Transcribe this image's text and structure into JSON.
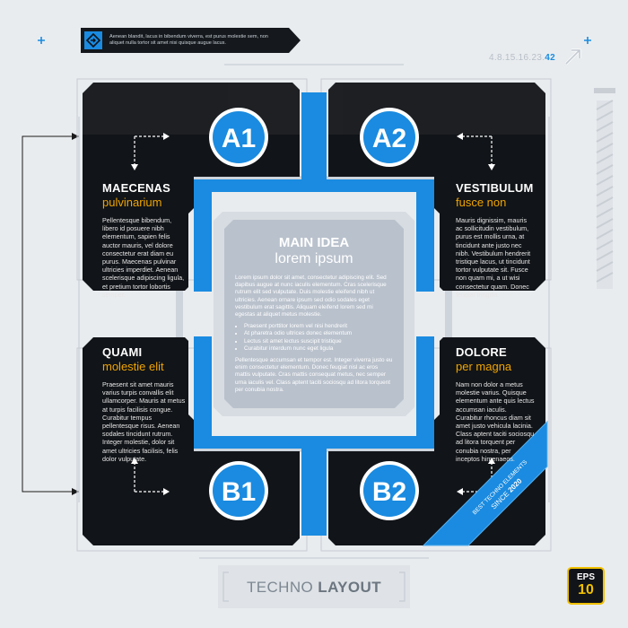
{
  "header": {
    "text_line1": "Aenean blandit, lacus in bibendum viverra, est purus molestie sem, non",
    "text_line2": "aliquet nulla tortor sit amet nisi quisque augue lacus.",
    "numbers_prefix": "4.8.15.16.23.",
    "numbers_highlight": "42"
  },
  "panels": {
    "a1": {
      "badge": "A1",
      "title": "MAECENAS",
      "subtitle": "pulvinarium",
      "body": "Pellentesque bibendum, libero id posuere nibh elementum, sapien felis auctor mauris, vel dolore consectetur erat diam eu purus. Maecenas pulvinar ultricies imperdiet. Aenean scelerisque adipiscing ligula, et pretium tortor lobortis semper."
    },
    "a2": {
      "badge": "A2",
      "title": "VESTIBULUM",
      "subtitle": "fusce non",
      "body": "Mauris dignissim, mauris ac sollicitudin vestibulum, purus est mollis urna, at tincidunt ante justo nec nibh. Vestibulum hendrerit tristique lacus, ut tincidunt tortor vulputate sit. Fusce non quam mi, a ut wisi consectetur quam. Donec feugiat fringilla."
    },
    "b1": {
      "badge": "B1",
      "title": "QUAMI",
      "subtitle": "molestie elit",
      "body": "Praesent sit amet mauris varius turpis convallis elit ullamcorper. Mauris at metus at turpis facilisis congue. Curabitur tempus pellentesque risus. Aenean sodales tincidunt rutrum. Integer molestie, dolor sit amet ultricies facilisis, felis dolor vulputate."
    },
    "b2": {
      "badge": "B2",
      "title": "DOLORE",
      "subtitle": "per magna",
      "body": "Nam non dolor a metus molestie varius. Quisque elementum ante quis lectus accumsan iaculis. Curabitur rhoncus diam sit amet justo vehicula lacinia. Class aptent taciti sociosqu ad litora torquent per conubia nostra, per inceptos himenaeos."
    }
  },
  "main": {
    "title": "MAIN IDEA",
    "subtitle": "lorem ipsum",
    "para1": "Lorem ipsum dolor sit amet, consectetur adipiscing elit. Sed dapibus augue at nunc iaculis elementum. Cras scelerisque rutrum elit sed vulputate. Duis molestie eleifend nibh ut ultricies. Aenean ornare ipsum sed odio sodales eget vestibulum erat sagittis. Aliquam eleifend lorem sed mi egestas at aliquet metus molestie.",
    "bullets": [
      "Praesent porttitor lorem vel nisi hendrerit",
      "At pharetra odio ultrices donec elementum",
      "Lectus sit amet lectus suscipit tristique",
      "Curabitur interdum nunc eget ligula"
    ],
    "para2": "Pellentesque accumsan et tempor est. Integer viverra justo eu enim consectetur elementum. Donec feugiat nisl ac eros mattis vulputate. Cras mattis consequat metus, nec semper urna iaculis vel. Class aptent taciti sociosqu ad litora torquent per conubia nostra."
  },
  "ribbon": {
    "line1": "BEST TECHNO ELEMENTS",
    "line2_prefix": "SINCE ",
    "line2_year": "2020"
  },
  "footer": {
    "title_light": "TECHNO ",
    "title_bold": "LAYOUT"
  },
  "eps_badge": {
    "label": "EPS",
    "number": "10"
  },
  "colors": {
    "panel": "#111418",
    "blue": "#1a8be0",
    "orange": "#f0a500",
    "main_box": "#b9c1cc",
    "background": "#e9ecef"
  },
  "icons": [
    "diamond-arrow-icon",
    "diagonal-arrow-icon",
    "plus-icon",
    "corner-arrow-icon",
    "connector-arrow-icon"
  ]
}
